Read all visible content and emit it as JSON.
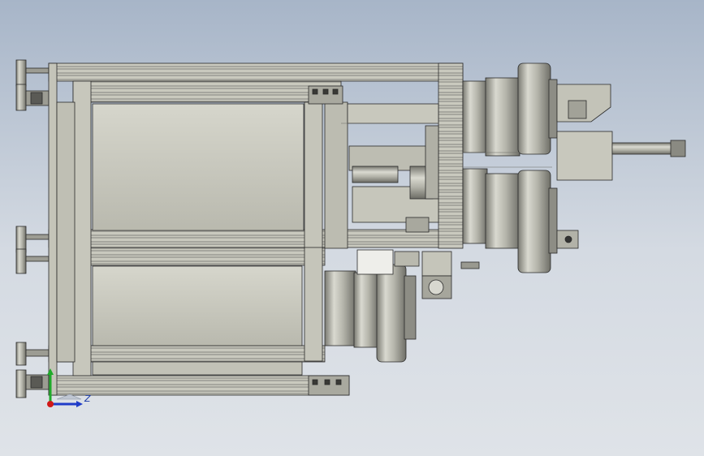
{
  "viewport": {
    "background_top": "#a7b5c8",
    "background_bottom": "#dfe3e8",
    "model_color": "#c8c8bd",
    "line_color": "#2a2a2a"
  },
  "triad": {
    "z_label": "Z",
    "z_color": "#1f3cc8",
    "y_color": "#1faa2a",
    "x_color": "#d01818"
  }
}
